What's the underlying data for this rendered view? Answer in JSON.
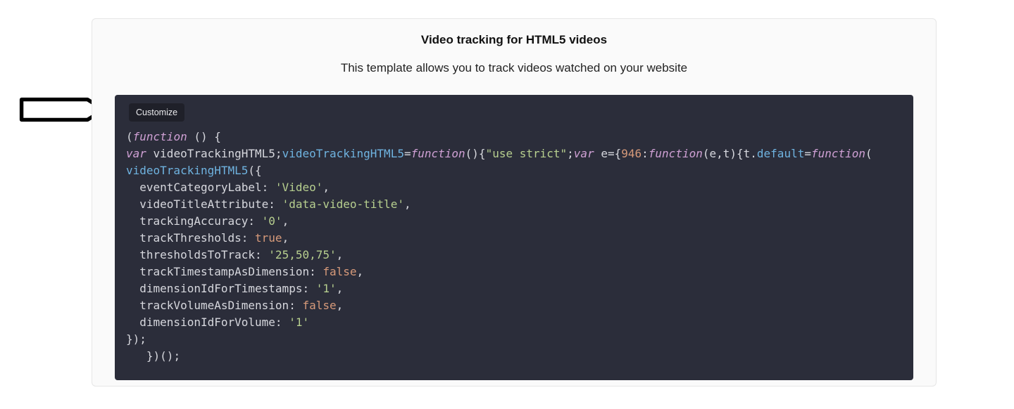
{
  "panel": {
    "title": "Video tracking for HTML5 videos",
    "subtitle": "This template allows you to track videos watched on your website"
  },
  "codebox": {
    "customize_label": "Customize"
  },
  "code": {
    "line1_open": "(",
    "line1_fn": "function",
    "line1_rest": " () {",
    "line2_var": "var",
    "line2_decl": " videoTrackingHTML5;",
    "line2_assign_lhs": "videoTrackingHTML5",
    "line2_eq": "=",
    "line2_fn": "function",
    "line2_after_fn": "(){",
    "line2_use_strict": "\"use strict\"",
    "line2_semi1": ";",
    "line2_var2": "var",
    "line2_e": " e={",
    "line2_num": "946",
    "line2_colon": ":",
    "line2_fn2": "function",
    "line2_after_fn2": "(e,t){t.",
    "line2_default": "default",
    "line2_eq2": "=",
    "line2_fn3": "function",
    "line2_tail": "(",
    "line3_call": "videoTrackingHTML5",
    "line3_open": "({",
    "p1_key": "eventCategoryLabel",
    "p1_val": "'Video'",
    "p2_key": "videoTitleAttribute",
    "p2_val": "'data-video-title'",
    "p3_key": "trackingAccuracy",
    "p3_val": "'0'",
    "p4_key": "trackThresholds",
    "p4_val": "true",
    "p5_key": "thresholdsToTrack",
    "p5_val": "'25,50,75'",
    "p6_key": "trackTimestampAsDimension",
    "p6_val": "false",
    "p7_key": "dimensionIdForTimestamps",
    "p7_val": "'1'",
    "p8_key": "trackVolumeAsDimension",
    "p8_val": "false",
    "p9_key": "dimensionIdForVolume",
    "p9_val": "'1'",
    "close_obj": "});",
    "iife_close": "})();",
    "colon_space": ": ",
    "comma": ","
  }
}
